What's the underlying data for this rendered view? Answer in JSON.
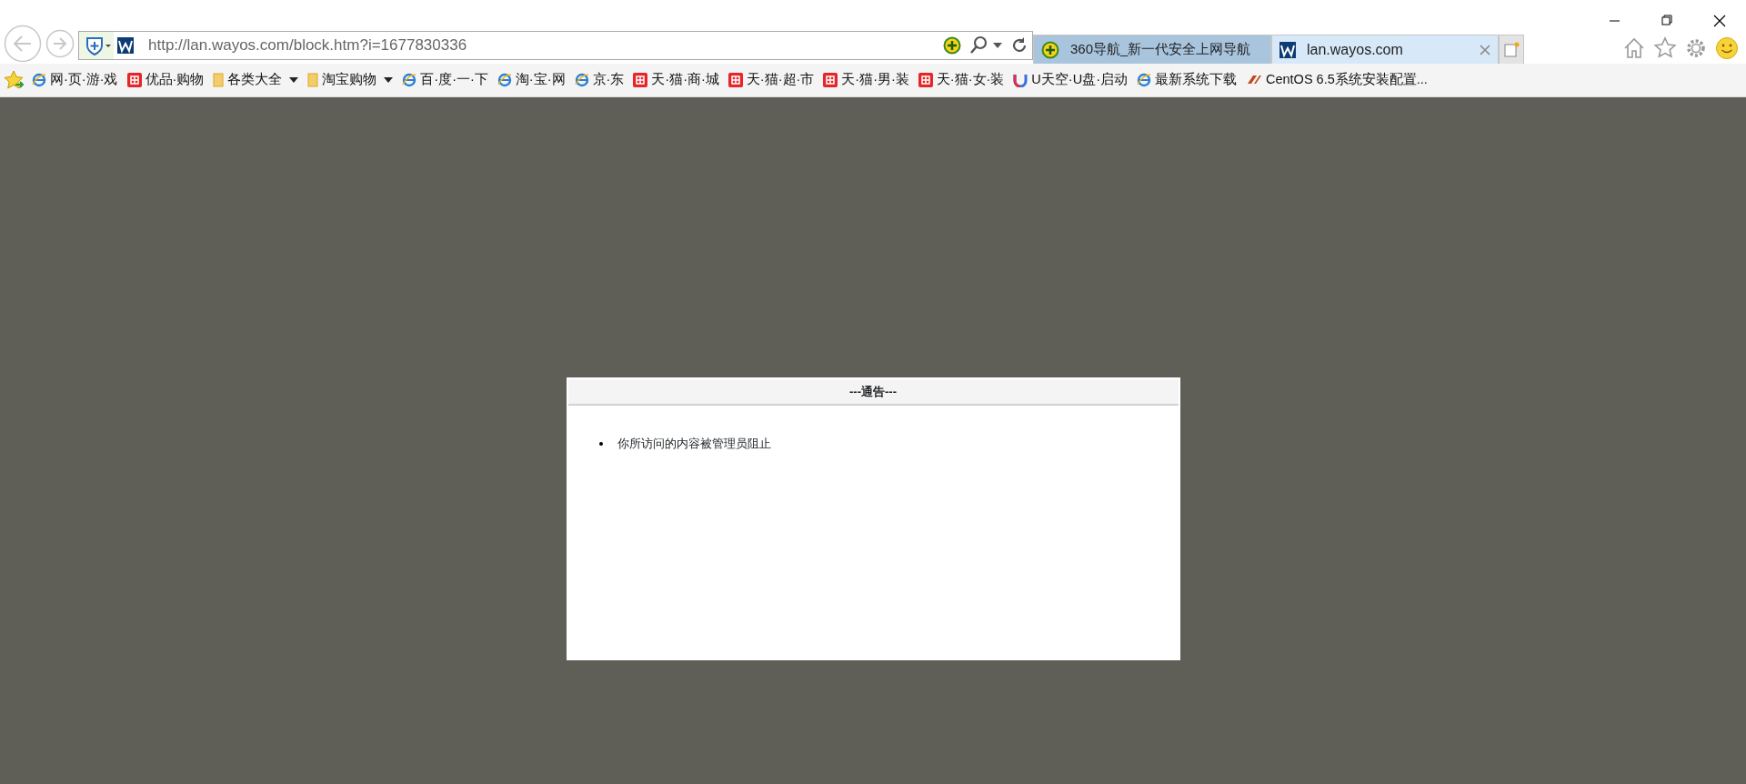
{
  "address_bar": {
    "url": "http://lan.wayos.com/block.htm?i=1677830336"
  },
  "tabs": [
    {
      "title": "360导航_新一代安全上网导航",
      "kind": "shield",
      "selected": false
    },
    {
      "title": "lan.wayos.com",
      "kind": "logo",
      "selected": true
    }
  ],
  "favorites": [
    {
      "label": "网·页·游·戏",
      "kind": "ie",
      "dropdown": false
    },
    {
      "label": "优品·购物",
      "kind": "taobao",
      "dropdown": false
    },
    {
      "label": "各类大全",
      "kind": "folder",
      "dropdown": true
    },
    {
      "label": "淘宝购物",
      "kind": "folder",
      "dropdown": true
    },
    {
      "label": "百·度·一·下",
      "kind": "ie",
      "dropdown": false
    },
    {
      "label": "淘·宝·网",
      "kind": "ie",
      "dropdown": false
    },
    {
      "label": "京·东",
      "kind": "ie",
      "dropdown": false
    },
    {
      "label": "天·猫·商·城",
      "kind": "taobao",
      "dropdown": false
    },
    {
      "label": "天·猫·超·市",
      "kind": "taobao",
      "dropdown": false
    },
    {
      "label": "天·猫·男·装",
      "kind": "taobao",
      "dropdown": false
    },
    {
      "label": "天·猫·女·装",
      "kind": "taobao",
      "dropdown": false
    },
    {
      "label": "U天空·U盘·启动",
      "kind": "u",
      "dropdown": false
    },
    {
      "label": "最新系统下载",
      "kind": "ie",
      "dropdown": false
    },
    {
      "label": "CentOS 6.5系统安装配置...",
      "kind": "jb",
      "dropdown": false
    }
  ],
  "notice": {
    "title": "---通告---",
    "items": [
      "你所访问的内容被管理员阻止"
    ]
  }
}
